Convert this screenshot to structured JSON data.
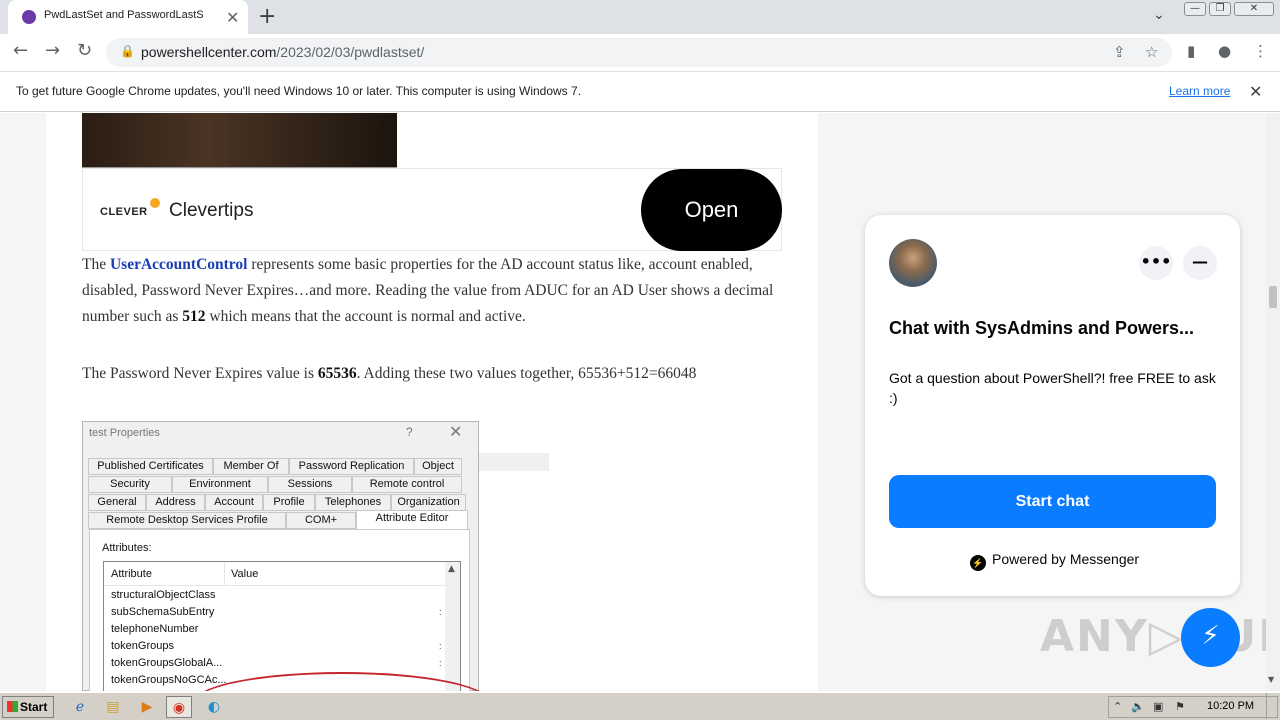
{
  "browser": {
    "tab_title": "PwdLastSet and PasswordLastSet",
    "tab_close": "✕",
    "new_tab": "+",
    "tab_search": "⌄",
    "url_host": "powershellcenter.com",
    "url_path": "/2023/02/03/pwdlastset/",
    "nav": {
      "back": "←",
      "forward": "→",
      "reload": "↻"
    },
    "window_controls": {
      "minimize": "—",
      "restore": "❐",
      "close": "✕"
    },
    "toolbar_icons": {
      "share": "⇪",
      "star": "☆",
      "sidepanel": "▮",
      "profile": "●",
      "menu": "⋮"
    }
  },
  "infobar": {
    "message": "To get future Google Chrome updates, you'll need Windows 10 or later. This computer is using Windows 7.",
    "learn_more": "Learn more",
    "close": "✕"
  },
  "ad": {
    "logo": "CLEVER",
    "name": "Clevertips",
    "button": "Open"
  },
  "article": {
    "p1": {
      "t1": "The ",
      "link": "UserAccountControl",
      "t2": " represents some basic properties for the AD account status like, account enabled, disabled, Password Never Expires…and more. Reading the value from ADUC for an AD User shows a decimal number such as ",
      "b1": "512",
      "t3": " which means that the account is normal and active."
    },
    "p2": {
      "t1": "The Password Never Expires value is ",
      "b1": "65536",
      "t2": ". Adding these two values together, 65536+512=66048"
    }
  },
  "dialog": {
    "title": "test Properties",
    "help": "?",
    "close": "✕",
    "tabs_row1": [
      "Published Certificates",
      "Member Of",
      "Password Replication",
      "Object"
    ],
    "tabs_row2": [
      "Security",
      "Environment",
      "Sessions",
      "Remote control"
    ],
    "tabs_row3": [
      "General",
      "Address",
      "Account",
      "Profile",
      "Telephones",
      "Organization"
    ],
    "tabs_row4": [
      "Remote Desktop Services Profile",
      "COM+",
      "Attribute Editor"
    ],
    "attributes_label": "Attributes:",
    "col_attribute": "Attribute",
    "col_value": "Value",
    "rows": [
      "structuralObjectClass",
      "subSchemaSubEntry",
      "telephoneNumber",
      "tokenGroups",
      "tokenGroupsGlobalA...",
      "tokenGroupsNoGCAc..."
    ]
  },
  "chat": {
    "title": "Chat with SysAdmins and Powers...",
    "description": "Got a question about PowerShell?! free FREE to ask :)",
    "more": "•••",
    "minimize": "—",
    "start_chat": "Start chat",
    "powered_by": "Powered by Messenger"
  },
  "watermark": "ANY▷RUN",
  "taskbar": {
    "start": "Start",
    "clock": "10:20 PM"
  }
}
